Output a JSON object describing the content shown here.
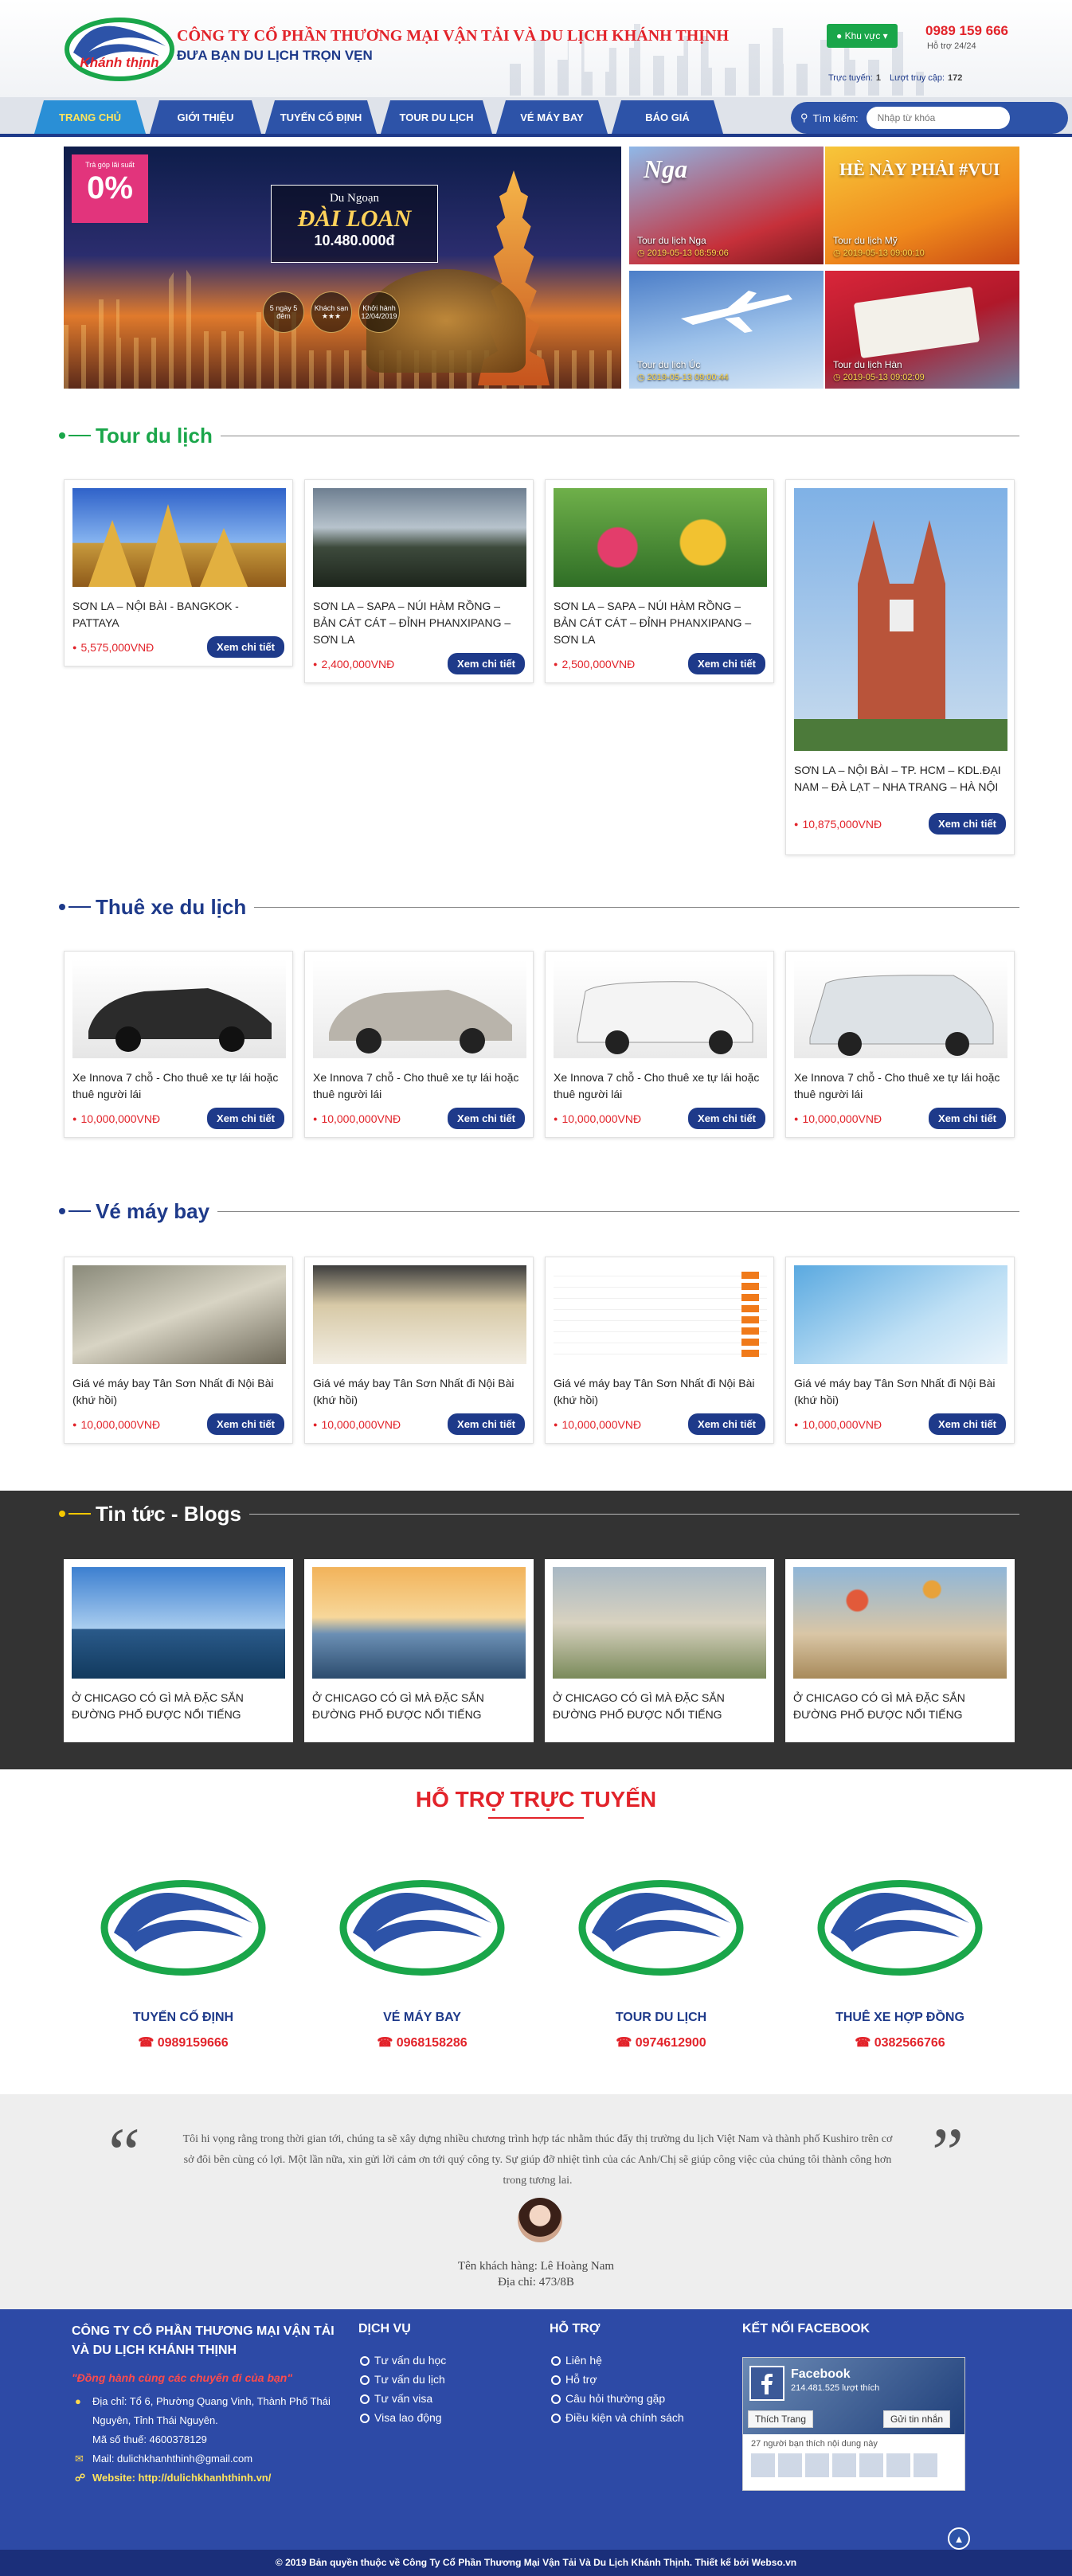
{
  "header": {
    "company": "CÔNG TY CỔ PHẦN THƯƠNG MẠI VẬN TẢI VÀ DU LỊCH KHÁNH THỊNH",
    "slogan": "ĐƯA BẠN DU LỊCH TRỌN VẸN",
    "logo_text": "Khánh thịnh",
    "region_button": "Khu vực",
    "hotline": "0989 159 666",
    "support": "Hỗ trợ 24/24",
    "online_label": "Trực tuyến:",
    "online_count": "1",
    "visits_label": "Lượt truy cập:",
    "visits_count": "172"
  },
  "nav": {
    "items": [
      "TRANG CHỦ",
      "GIỚI THIỆU",
      "TUYẾN CỐ ĐỊNH",
      "TOUR DU LỊCH",
      "VÉ MÁY BAY",
      "BÁO GIÁ"
    ],
    "search_label": "Tìm kiếm:",
    "search_placeholder": "Nhập từ khóa"
  },
  "hero": {
    "promo_top": "Trả góp lãi suất",
    "promo_value": "0%",
    "title_1": "Du Ngoạn",
    "title_2": "ĐÀI LOAN",
    "title_3": "10.480.000đ",
    "badges": [
      "5 ngày 5 đêm",
      "Khách sạn ★★★",
      "Khởi hành 12/04/2019"
    ],
    "side": [
      {
        "name": "Tour du lịch Nga",
        "time": "2019-05-13 08:59:06",
        "big": "Nga"
      },
      {
        "name": "Tour du lịch Mỹ",
        "time": "2019-05-13 09:00:10",
        "big": "HÈ NÀY PHẢI #VUI"
      },
      {
        "name": "Tour du lịch Úc",
        "time": "2019-05-13 09:00:44",
        "big": ""
      },
      {
        "name": "Tour du lịch Hàn",
        "time": "2019-05-13 09:02:09",
        "big": ""
      }
    ]
  },
  "tours": {
    "title": "Tour du lịch",
    "items": [
      {
        "name": "SƠN LA – NỘI BÀI - BANGKOK - PATTAYA",
        "price": "5,575,000VNĐ"
      },
      {
        "name": "SƠN LA – SAPA – NÚI HÀM RỒNG – BẢN CÁT CÁT – ĐỈNH PHANXIPANG – SƠN LA",
        "price": "2,400,000VNĐ"
      },
      {
        "name": "SƠN LA – SAPA – NÚI HÀM RỒNG – BẢN CÁT CÁT – ĐỈNH PHANXIPANG – SƠN LA",
        "price": "2,500,000VNĐ"
      },
      {
        "name": "SƠN LA – NỘI BÀI – TP. HCM – KDL.ĐẠI NAM – ĐÀ LẠT – NHA TRANG – HÀ NỘI",
        "price": "10,875,000VNĐ"
      }
    ]
  },
  "cars": {
    "title": "Thuê xe du lịch",
    "items": [
      {
        "name": "Xe Innova 7 chỗ - Cho thuê xe tự lái hoặc thuê người lái",
        "price": "10,000,000VNĐ"
      },
      {
        "name": "Xe Innova 7 chỗ - Cho thuê xe tự lái hoặc thuê người lái",
        "price": "10,000,000VNĐ"
      },
      {
        "name": "Xe Innova 7 chỗ - Cho thuê xe tự lái hoặc thuê người lái",
        "price": "10,000,000VNĐ"
      },
      {
        "name": "Xe Innova 7 chỗ - Cho thuê xe tự lái hoặc thuê người lái",
        "price": "10,000,000VNĐ"
      }
    ]
  },
  "flights": {
    "title": "Vé máy bay",
    "items": [
      {
        "name": "Giá vé máy bay Tân Sơn Nhất đi Nội Bài (khứ hồi)",
        "price": "10,000,000VNĐ"
      },
      {
        "name": "Giá vé máy bay Tân Sơn Nhất đi Nội Bài (khứ hồi)",
        "price": "10,000,000VNĐ"
      },
      {
        "name": "Giá vé máy bay Tân Sơn Nhất đi Nội Bài (khứ hồi)",
        "price": "10,000,000VNĐ"
      },
      {
        "name": "Giá vé máy bay Tân Sơn Nhất đi Nội Bài (khứ hồi)",
        "price": "10,000,000VNĐ"
      }
    ]
  },
  "detail_button": "Xem chi tiết",
  "blogs": {
    "title": "Tin tức - Blogs",
    "items": [
      "Ở CHICAGO CÓ GÌ MÀ ĐẶC SẮN ĐƯỜNG PHỐ ĐƯỢC NỔI TIẾNG",
      "Ở CHICAGO CÓ GÌ MÀ ĐẶC SẮN ĐƯỜNG PHỐ ĐƯỢC NỔI TIẾNG",
      "Ở CHICAGO CÓ GÌ MÀ ĐẶC SẮN ĐƯỜNG PHỐ ĐƯỢC NỔI TIẾNG",
      "Ở CHICAGO CÓ GÌ MÀ ĐẶC SẮN ĐƯỜNG PHỐ ĐƯỢC NỔI TIẾNG"
    ]
  },
  "support": {
    "title": "HỖ TRỢ TRỰC TUYẾN",
    "items": [
      {
        "title": "TUYẾN CỐ ĐỊNH",
        "phone": "0989159666"
      },
      {
        "title": "VÉ MÁY BAY",
        "phone": "0968158286"
      },
      {
        "title": "TOUR DU LỊCH",
        "phone": "0974612900"
      },
      {
        "title": "THUÊ XE HỢP ĐỒNG",
        "phone": "0382566766"
      }
    ]
  },
  "testimonial": {
    "text": "Tôi hi vọng rằng trong thời gian tới, chúng ta sẽ xây dựng nhiều chương trình hợp tác nhằm thúc đẩy thị trường du lịch Việt Nam và thành phố Kushiro trên cơ sở đôi bên cùng có lợi. Một lần nữa, xin gửi lời cảm ơn tới quý công ty. Sự giúp đỡ nhiệt tình của các Anh/Chị sẽ giúp công việc của chúng tôi thành công hơn trong tương lai.",
    "customer": "Tên khách hàng: Lê Hoàng Nam",
    "address": "Địa chỉ: 473/8B"
  },
  "footer": {
    "company": "CÔNG TY CỔ PHẦN THƯƠNG MẠI VẬN TẢI VÀ DU LỊCH KHÁNH THỊNH",
    "slogan": "\"Đồng hành cùng các chuyến đi của bạn\"",
    "address": "Địa chỉ: Tổ 6, Phường Quang Vinh, Thành Phố Thái Nguyên, Tỉnh Thái Nguyên.",
    "tax": "Mã số thuế: 4600378129",
    "mail": "Mail: dulichkhanhthinh@gmail.com",
    "website": "Website: http://dulichkhanhthinh.vn/",
    "services_title": "DỊCH VỤ",
    "services": [
      "Tư vấn du học",
      "Tư vấn du lịch",
      "Tư vấn visa",
      "Visa lao động"
    ],
    "help_title": "HỖ TRỢ",
    "help": [
      "Liên hệ",
      "Hỗ trợ",
      "Câu hỏi thường gặp",
      "Điều kiện và chính sách"
    ],
    "fb_title": "KẾT NỐI FACEBOOK",
    "fb_name": "Facebook",
    "fb_likes": "214.481.525 lượt thích",
    "fb_like_btn": "Thích Trang",
    "fb_share_btn": "Gửi tin nhắn",
    "fb_friends": "27 người bạn thích nội dung này",
    "copyright": "© 2019 Bản quyền thuộc về Công Ty Cổ Phần Thương Mại Vận Tải Và Du Lịch Khánh Thịnh. Thiết kế bởi Webso.vn"
  }
}
